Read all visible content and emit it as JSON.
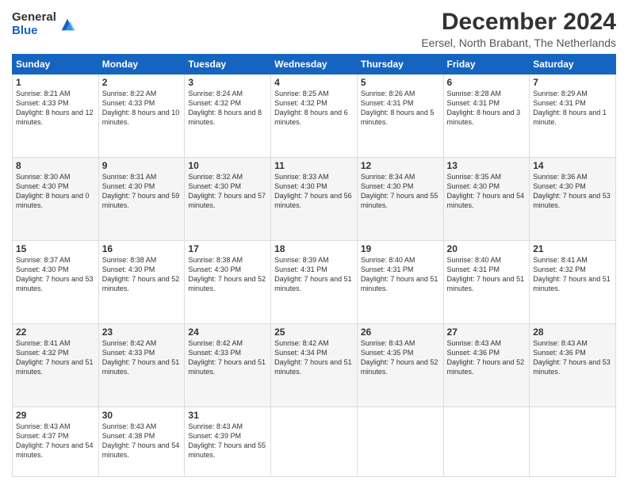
{
  "logo": {
    "general": "General",
    "blue": "Blue"
  },
  "title": "December 2024",
  "subtitle": "Eersel, North Brabant, The Netherlands",
  "days_header": [
    "Sunday",
    "Monday",
    "Tuesday",
    "Wednesday",
    "Thursday",
    "Friday",
    "Saturday"
  ],
  "weeks": [
    [
      {
        "day": "1",
        "sunrise": "8:21 AM",
        "sunset": "4:33 PM",
        "daylight": "8 hours and 12 minutes."
      },
      {
        "day": "2",
        "sunrise": "8:22 AM",
        "sunset": "4:33 PM",
        "daylight": "8 hours and 10 minutes."
      },
      {
        "day": "3",
        "sunrise": "8:24 AM",
        "sunset": "4:32 PM",
        "daylight": "8 hours and 8 minutes."
      },
      {
        "day": "4",
        "sunrise": "8:25 AM",
        "sunset": "4:32 PM",
        "daylight": "8 hours and 6 minutes."
      },
      {
        "day": "5",
        "sunrise": "8:26 AM",
        "sunset": "4:31 PM",
        "daylight": "8 hours and 5 minutes."
      },
      {
        "day": "6",
        "sunrise": "8:28 AM",
        "sunset": "4:31 PM",
        "daylight": "8 hours and 3 minutes."
      },
      {
        "day": "7",
        "sunrise": "8:29 AM",
        "sunset": "4:31 PM",
        "daylight": "8 hours and 1 minute."
      }
    ],
    [
      {
        "day": "8",
        "sunrise": "8:30 AM",
        "sunset": "4:30 PM",
        "daylight": "8 hours and 0 minutes."
      },
      {
        "day": "9",
        "sunrise": "8:31 AM",
        "sunset": "4:30 PM",
        "daylight": "7 hours and 59 minutes."
      },
      {
        "day": "10",
        "sunrise": "8:32 AM",
        "sunset": "4:30 PM",
        "daylight": "7 hours and 57 minutes."
      },
      {
        "day": "11",
        "sunrise": "8:33 AM",
        "sunset": "4:30 PM",
        "daylight": "7 hours and 56 minutes."
      },
      {
        "day": "12",
        "sunrise": "8:34 AM",
        "sunset": "4:30 PM",
        "daylight": "7 hours and 55 minutes."
      },
      {
        "day": "13",
        "sunrise": "8:35 AM",
        "sunset": "4:30 PM",
        "daylight": "7 hours and 54 minutes."
      },
      {
        "day": "14",
        "sunrise": "8:36 AM",
        "sunset": "4:30 PM",
        "daylight": "7 hours and 53 minutes."
      }
    ],
    [
      {
        "day": "15",
        "sunrise": "8:37 AM",
        "sunset": "4:30 PM",
        "daylight": "7 hours and 53 minutes."
      },
      {
        "day": "16",
        "sunrise": "8:38 AM",
        "sunset": "4:30 PM",
        "daylight": "7 hours and 52 minutes."
      },
      {
        "day": "17",
        "sunrise": "8:38 AM",
        "sunset": "4:30 PM",
        "daylight": "7 hours and 52 minutes."
      },
      {
        "day": "18",
        "sunrise": "8:39 AM",
        "sunset": "4:31 PM",
        "daylight": "7 hours and 51 minutes."
      },
      {
        "day": "19",
        "sunrise": "8:40 AM",
        "sunset": "4:31 PM",
        "daylight": "7 hours and 51 minutes."
      },
      {
        "day": "20",
        "sunrise": "8:40 AM",
        "sunset": "4:31 PM",
        "daylight": "7 hours and 51 minutes."
      },
      {
        "day": "21",
        "sunrise": "8:41 AM",
        "sunset": "4:32 PM",
        "daylight": "7 hours and 51 minutes."
      }
    ],
    [
      {
        "day": "22",
        "sunrise": "8:41 AM",
        "sunset": "4:32 PM",
        "daylight": "7 hours and 51 minutes."
      },
      {
        "day": "23",
        "sunrise": "8:42 AM",
        "sunset": "4:33 PM",
        "daylight": "7 hours and 51 minutes."
      },
      {
        "day": "24",
        "sunrise": "8:42 AM",
        "sunset": "4:33 PM",
        "daylight": "7 hours and 51 minutes."
      },
      {
        "day": "25",
        "sunrise": "8:42 AM",
        "sunset": "4:34 PM",
        "daylight": "7 hours and 51 minutes."
      },
      {
        "day": "26",
        "sunrise": "8:43 AM",
        "sunset": "4:35 PM",
        "daylight": "7 hours and 52 minutes."
      },
      {
        "day": "27",
        "sunrise": "8:43 AM",
        "sunset": "4:36 PM",
        "daylight": "7 hours and 52 minutes."
      },
      {
        "day": "28",
        "sunrise": "8:43 AM",
        "sunset": "4:36 PM",
        "daylight": "7 hours and 53 minutes."
      }
    ],
    [
      {
        "day": "29",
        "sunrise": "8:43 AM",
        "sunset": "4:37 PM",
        "daylight": "7 hours and 54 minutes."
      },
      {
        "day": "30",
        "sunrise": "8:43 AM",
        "sunset": "4:38 PM",
        "daylight": "7 hours and 54 minutes."
      },
      {
        "day": "31",
        "sunrise": "8:43 AM",
        "sunset": "4:39 PM",
        "daylight": "7 hours and 55 minutes."
      },
      null,
      null,
      null,
      null
    ]
  ],
  "labels": {
    "sunrise": "Sunrise: ",
    "sunset": "Sunset: ",
    "daylight": "Daylight: "
  }
}
